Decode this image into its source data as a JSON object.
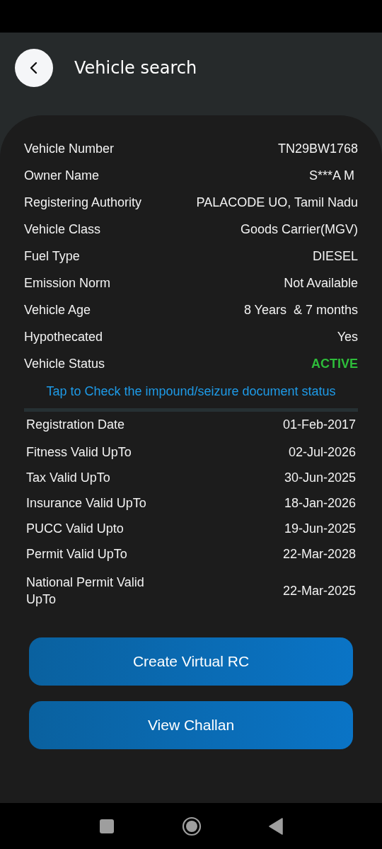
{
  "header": {
    "title": "Vehicle search"
  },
  "vehicle_details": [
    {
      "label": "Vehicle Number",
      "value": "TN29BW1768"
    },
    {
      "label": "Owner Name",
      "value": "S***A M "
    },
    {
      "label": "Registering Authority",
      "value": "PALACODE UO, Tamil Nadu"
    },
    {
      "label": "Vehicle Class",
      "value": "Goods Carrier(MGV)"
    },
    {
      "label": "Fuel Type",
      "value": "DIESEL"
    },
    {
      "label": "Emission Norm",
      "value": "Not Available"
    },
    {
      "label": "Vehicle Age",
      "value": "8 Years  & 7 months"
    },
    {
      "label": "Hypothecated",
      "value": "Yes"
    },
    {
      "label": "Vehicle Status",
      "value": "ACTIVE",
      "color": "#2ebd3a"
    }
  ],
  "impound_link": "Tap to Check the impound/seizure document status",
  "validity_details": [
    {
      "label": "Registration Date",
      "value": "01-Feb-2017"
    },
    {
      "label": "Fitness Valid UpTo",
      "value": "02-Jul-2026"
    },
    {
      "label": "Tax Valid UpTo",
      "value": "30-Jun-2025"
    },
    {
      "label": "Insurance Valid UpTo",
      "value": "18-Jan-2026"
    },
    {
      "label": "PUCC Valid Upto",
      "value": "19-Jun-2025"
    },
    {
      "label": "Permit Valid UpTo",
      "value": "22-Mar-2028"
    },
    {
      "label": "National Permit Valid UpTo",
      "value": "22-Mar-2025"
    }
  ],
  "buttons": [
    "Create Virtual RC",
    "View Challan"
  ]
}
